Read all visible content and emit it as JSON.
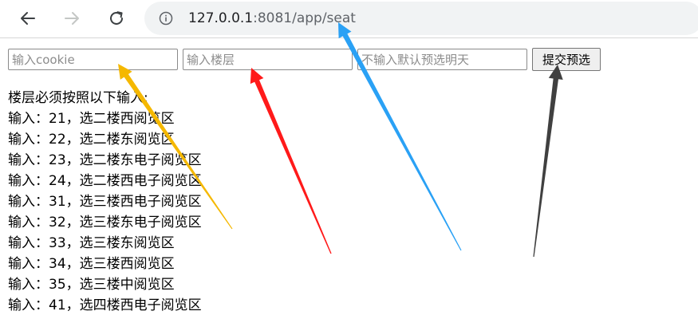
{
  "browser": {
    "url_host": "127.0.0.1",
    "url_rest": ":8081/app/seat",
    "icons": [
      "back-arrow-icon",
      "forward-arrow-icon",
      "reload-icon",
      "info-icon"
    ]
  },
  "form": {
    "cookie_placeholder": "输入cookie",
    "floor_placeholder": "输入楼层",
    "date_placeholder": "不输入默认预选明天",
    "submit_label": "提交预选"
  },
  "instructions": {
    "heading": "楼层必须按照以下输入:",
    "lines": [
      "输入：21，选二楼西阅览区",
      "输入：22，选二楼东阅览区",
      "输入：23，选二楼东电子阅览区",
      "输入：24，选二楼西电子阅览区",
      "输入：31，选三楼西电子阅览区",
      "输入：32，选三楼东电子阅览区",
      "输入：33，选三楼东阅览区",
      "输入：34，选三楼西阅览区",
      "输入：35，选三楼中阅览区",
      "输入：41，选四楼西电子阅览区"
    ]
  },
  "annotations": {
    "colors": [
      "#f5b800",
      "#ff1a1a",
      "#2aa1f5",
      "#404040"
    ]
  }
}
